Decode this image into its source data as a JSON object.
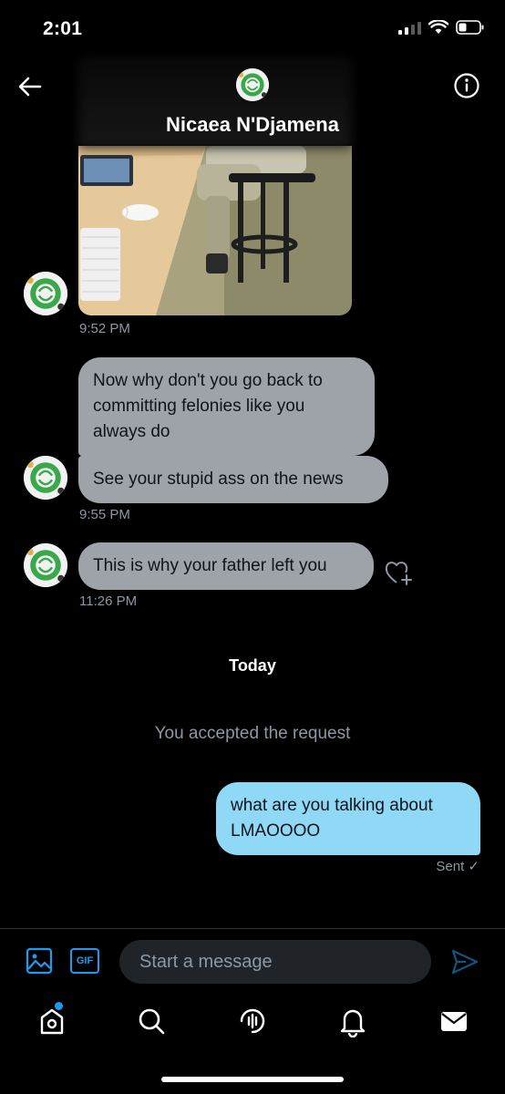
{
  "status_bar": {
    "time": "2:01"
  },
  "header": {
    "contact_name": "Nicaea N'Djamena"
  },
  "messages": {
    "photo_timestamp": "9:52 PM",
    "group1": {
      "bubble1": "Now why don't you go back to committing felonies like you always do",
      "bubble2": "See your stupid ass on the news",
      "timestamp": "9:55 PM"
    },
    "group2": {
      "bubble1": "This is why your father left you",
      "timestamp": "11:26 PM"
    },
    "day_divider": "Today",
    "system_message": "You accepted the request",
    "outgoing": {
      "text": "what are you talking about LMAOOOO",
      "status": "Sent ✓"
    }
  },
  "composer": {
    "gif_label": "GIF",
    "placeholder": "Start a message"
  },
  "colors": {
    "accent": "#1d9bf0",
    "incoming_bubble": "#9ea3aa",
    "outgoing_bubble": "#8fd8f6",
    "muted_text": "#8b98a5"
  },
  "icons": {
    "back": "arrow-left-icon",
    "info": "info-icon",
    "media": "image-icon",
    "send": "send-icon",
    "heart": "heart-plus-icon",
    "tabs": [
      "home-icon",
      "search-icon",
      "spaces-icon",
      "bell-icon",
      "mail-icon"
    ]
  }
}
